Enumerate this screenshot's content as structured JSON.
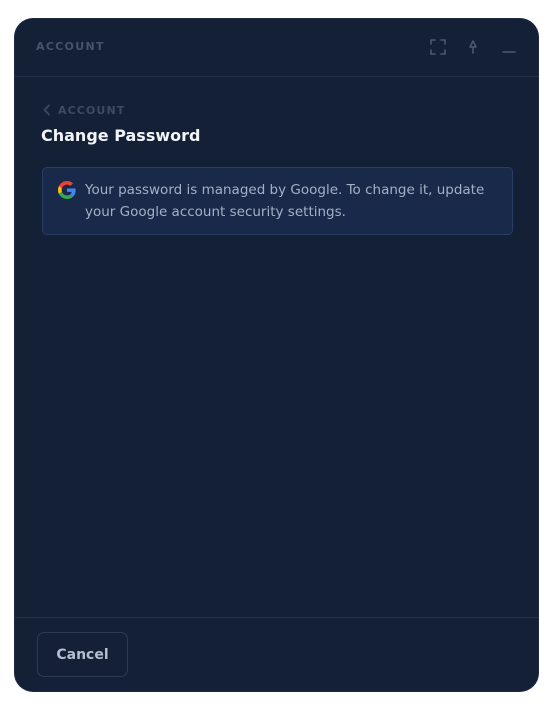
{
  "window": {
    "title": "ACCOUNT",
    "controls": {
      "expand_icon": "expand-icon",
      "pin_icon": "pin-icon",
      "minimize_icon": "minimize-icon"
    }
  },
  "breadcrumb": {
    "back_label": "ACCOUNT",
    "back_icon": "chevron-left-icon"
  },
  "page": {
    "title": "Change Password"
  },
  "notice": {
    "icon": "google-icon",
    "text": "Your password is managed by Google. To change it, update your Google account security settings."
  },
  "footer": {
    "cancel_label": "Cancel"
  },
  "colors": {
    "panel_background": "#142036",
    "notice_background": "#18294a",
    "notice_border": "#2a3d63",
    "title_text": "#f2f4f8",
    "muted_text": "#45536c"
  }
}
